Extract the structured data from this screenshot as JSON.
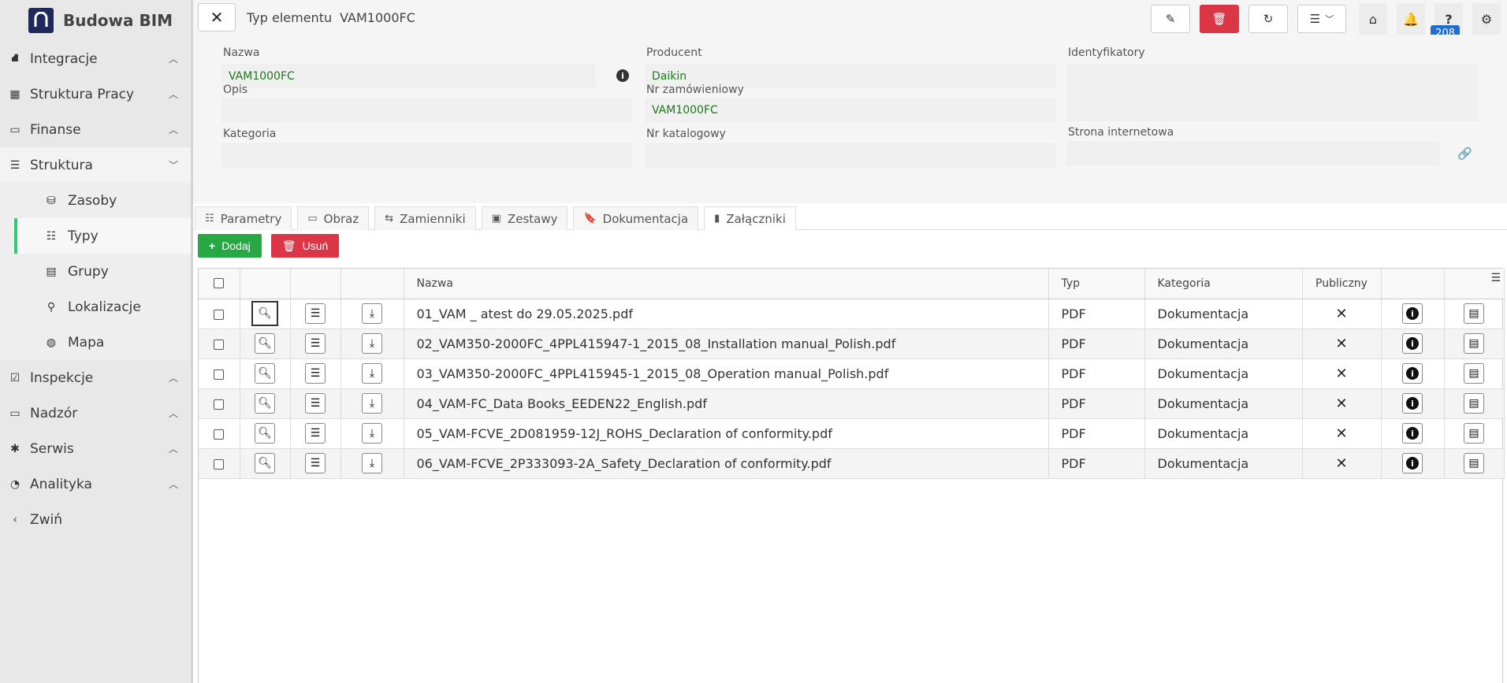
{
  "brand": {
    "name": "Budowa BIM"
  },
  "sidebar": {
    "items": [
      {
        "label": "Integracje",
        "icon": "integration-icon",
        "chevron": "up"
      },
      {
        "label": "Struktura Pracy",
        "icon": "building-icon",
        "chevron": "up"
      },
      {
        "label": "Finanse",
        "icon": "money-icon",
        "chevron": "up"
      },
      {
        "label": "Struktura",
        "icon": "tree-icon",
        "chevron": "down"
      },
      {
        "label": "Inspekcje",
        "icon": "checkbox-icon",
        "chevron": "up"
      },
      {
        "label": "Nadzór",
        "icon": "ruler-icon",
        "chevron": "up"
      },
      {
        "label": "Serwis",
        "icon": "bug-icon",
        "chevron": "up"
      },
      {
        "label": "Analityka",
        "icon": "gauge-icon",
        "chevron": "up"
      },
      {
        "label": "Zwiń",
        "icon": "chevron-left-icon",
        "chevron": ""
      }
    ],
    "sub_items": [
      {
        "label": "Zasoby",
        "icon": "database-icon"
      },
      {
        "label": "Typy",
        "icon": "list-icon"
      },
      {
        "label": "Grupy",
        "icon": "groups-icon"
      },
      {
        "label": "Lokalizacje",
        "icon": "pin-icon"
      },
      {
        "label": "Mapa",
        "icon": "globe-icon"
      }
    ]
  },
  "topbar": {
    "title_label": "Typ elementu",
    "title_value": "VAM1000FC",
    "badge": "208"
  },
  "form": {
    "nazwa": {
      "label": "Nazwa",
      "value": "VAM1000FC"
    },
    "opis": {
      "label": "Opis",
      "value": ""
    },
    "kategoria": {
      "label": "Kategoria",
      "value": ""
    },
    "producent": {
      "label": "Producent",
      "value": "Daikin"
    },
    "nr_zam": {
      "label": "Nr zamówieniowy",
      "value": "VAM1000FC"
    },
    "nr_kat": {
      "label": "Nr katalogowy",
      "value": ""
    },
    "identyfikatory": {
      "label": "Identyfikatory",
      "value": ""
    },
    "strona": {
      "label": "Strona internetowa",
      "value": ""
    }
  },
  "tabs": [
    {
      "label": "Parametry",
      "icon": "list-icon"
    },
    {
      "label": "Obraz",
      "icon": "image-icon"
    },
    {
      "label": "Zamienniki",
      "icon": "swap-icon"
    },
    {
      "label": "Zestawy",
      "icon": "box-icon"
    },
    {
      "label": "Dokumentacja",
      "icon": "bookmark-icon"
    },
    {
      "label": "Załączniki",
      "icon": "file-icon"
    }
  ],
  "actions": {
    "add": "Dodaj",
    "remove": "Usuń"
  },
  "table": {
    "headers": {
      "name": "Nazwa",
      "type": "Typ",
      "category": "Kategoria",
      "public": "Publiczny"
    },
    "rows": [
      {
        "name": "01_VAM _ atest do 29.05.2025.pdf",
        "type": "PDF",
        "category": "Dokumentacja"
      },
      {
        "name": "02_VAM350-2000FC_4PPL415947-1_2015_08_Installation manual_Polish.pdf",
        "type": "PDF",
        "category": "Dokumentacja"
      },
      {
        "name": "03_VAM350-2000FC_4PPL415945-1_2015_08_Operation manual_Polish.pdf",
        "type": "PDF",
        "category": "Dokumentacja"
      },
      {
        "name": "04_VAM-FC_Data Books_EEDEN22_English.pdf",
        "type": "PDF",
        "category": "Dokumentacja"
      },
      {
        "name": "05_VAM-FCVE_2D081959-12J_ROHS_Declaration of conformity.pdf",
        "type": "PDF",
        "category": "Dokumentacja"
      },
      {
        "name": "06_VAM-FCVE_2P333093-2A_Safety_Declaration of conformity.pdf",
        "type": "PDF",
        "category": "Dokumentacja"
      }
    ]
  },
  "colors": {
    "accent_green": "#28a745",
    "danger_red": "#dc3545",
    "badge_blue": "#1d6fd6",
    "value_green": "#1b7a1b"
  }
}
